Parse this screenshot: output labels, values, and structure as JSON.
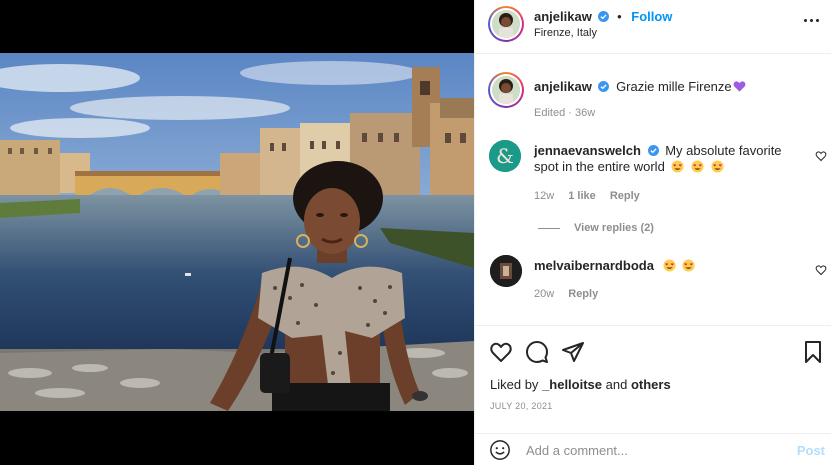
{
  "post": {
    "username": "anjelikaw",
    "verified": true,
    "follow_label": "Follow",
    "separator": "•",
    "location": "Firenze, Italy",
    "photo_icon": "photo-ponte-vecchio"
  },
  "caption": {
    "username": "anjelikaw",
    "text": "Grazie mille Firenze",
    "emoji": "purple-heart-emoji",
    "edited": "Edited · 36w"
  },
  "comments": [
    {
      "username": "jennaevanswelch",
      "verified": true,
      "text": "My absolute favorite spot in the entire world",
      "emoji": "heart-eyes-emoji",
      "emoji_count": 3,
      "time": "12w",
      "likes": "1 like",
      "reply_label": "Reply",
      "view_replies": "View replies (2)"
    },
    {
      "username": "melvaibernardboda",
      "verified": false,
      "text": "",
      "emoji": "heart-eyes-emoji",
      "emoji_count": 2,
      "time": "20w",
      "reply_label": "Reply"
    }
  ],
  "actions": {
    "liked_prefix": "Liked by",
    "liked_user": "_helloitse",
    "liked_and": "and",
    "liked_others": "others",
    "date": "JULY 20, 2021"
  },
  "add_comment": {
    "placeholder": "Add a comment...",
    "post_label": "Post"
  },
  "colors": {
    "link_blue": "#0095f6",
    "verified_blue": "#3897f0",
    "post_disabled": "#b2dffc",
    "muted": "#8e8e8e"
  }
}
